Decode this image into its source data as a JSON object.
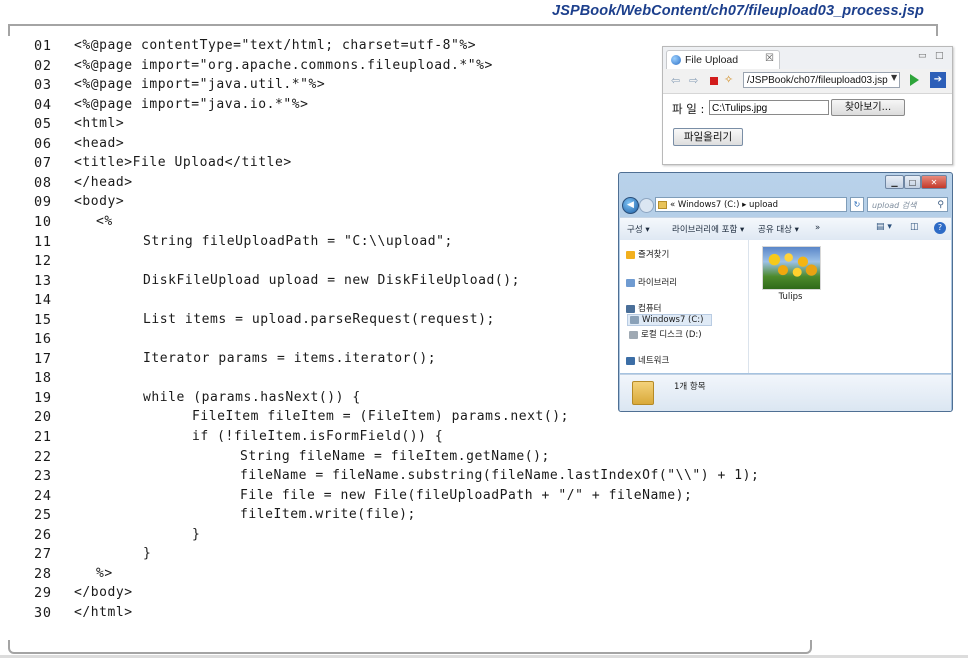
{
  "header": {
    "path": "JSPBook/WebContent/ch07/fileupload03_process.jsp"
  },
  "code": [
    {
      "num": "01",
      "text": "<%@page contentType=\"text/html; charset=utf-8\"%>",
      "indent": 0
    },
    {
      "num": "02",
      "text": "<%@page import=\"org.apache.commons.fileupload.*\"%>",
      "indent": 0
    },
    {
      "num": "03",
      "text": "<%@page import=\"java.util.*\"%>",
      "indent": 0
    },
    {
      "num": "04",
      "text": "<%@page import=\"java.io.*\"%>",
      "indent": 0
    },
    {
      "num": "05",
      "text": "<html>",
      "indent": 0
    },
    {
      "num": "06",
      "text": "<head>",
      "indent": 0
    },
    {
      "num": "07",
      "text": "<title>File Upload</title>",
      "indent": 0
    },
    {
      "num": "08",
      "text": "</head>",
      "indent": 0
    },
    {
      "num": "09",
      "text": "<body>",
      "indent": 0
    },
    {
      "num": "10",
      "text": "<%",
      "indent": 1
    },
    {
      "num": "11",
      "text": "String fileUploadPath = \"C:\\\\upload\";",
      "indent": 2
    },
    {
      "num": "12",
      "text": "",
      "indent": 0
    },
    {
      "num": "13",
      "text": "DiskFileUpload upload = new DiskFileUpload();",
      "indent": 2
    },
    {
      "num": "14",
      "text": "",
      "indent": 0
    },
    {
      "num": "15",
      "text": "List items = upload.parseRequest(request);",
      "indent": 2
    },
    {
      "num": "16",
      "text": "",
      "indent": 0
    },
    {
      "num": "17",
      "text": "Iterator params = items.iterator();",
      "indent": 2
    },
    {
      "num": "18",
      "text": "",
      "indent": 0
    },
    {
      "num": "19",
      "text": "while (params.hasNext()) {",
      "indent": 2
    },
    {
      "num": "20",
      "text": "FileItem fileItem = (FileItem) params.next();",
      "indent": 3
    },
    {
      "num": "21",
      "text": "if (!fileItem.isFormField()) {",
      "indent": 3
    },
    {
      "num": "22",
      "text": "String fileName = fileItem.getName();",
      "indent": 4
    },
    {
      "num": "23",
      "text": "fileName = fileName.substring(fileName.lastIndexOf(\"\\\\\") + 1);",
      "indent": 4
    },
    {
      "num": "24",
      "text": "File file = new File(fileUploadPath + \"/\" + fileName);",
      "indent": 4
    },
    {
      "num": "25",
      "text": "fileItem.write(file);",
      "indent": 4
    },
    {
      "num": "26",
      "text": "}",
      "indent": 3
    },
    {
      "num": "27",
      "text": "}",
      "indent": 2
    },
    {
      "num": "28",
      "text": "%>",
      "indent": 1
    },
    {
      "num": "29",
      "text": "</body>",
      "indent": 0
    },
    {
      "num": "30",
      "text": "</html>",
      "indent": 0
    }
  ],
  "browser": {
    "tab_title": "File Upload",
    "tab_close": "☒",
    "minimize": "▭",
    "maximize": "□",
    "url": "/JSPBook/ch07/fileupload03.jsp",
    "file_label": "파 일 :",
    "file_value": "C:\\Tulips.jpg",
    "browse_button": "찾아보기...",
    "upload_button": "파일올리기"
  },
  "explorer": {
    "address": "« Windows7 (C:) ▸ upload",
    "search_placeholder": "upload 검색",
    "toolbar": {
      "organize": "구성 ▾",
      "include_library": "라이브러리에 포함 ▾",
      "share": "공유 대상 ▾",
      "more": "»"
    },
    "nav": {
      "favorites": "즐겨찾기",
      "libraries": "라이브러리",
      "computer": "컴퓨터",
      "windows7": "Windows7 (C:)",
      "local_disk": "로컬 디스크 (D:)",
      "network": "네트워크"
    },
    "file_name": "Tulips",
    "details": "1개 항목"
  }
}
